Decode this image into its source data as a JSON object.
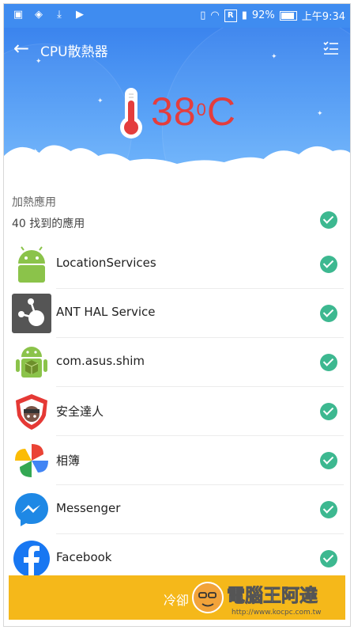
{
  "status_bar": {
    "battery": "92%",
    "time": "上午9:34",
    "sim_label": "R"
  },
  "header": {
    "title": "CPU散熱器",
    "temperature": "38",
    "unit": "C"
  },
  "section": {
    "title": "加熱應用",
    "found": "40 找到的應用"
  },
  "apps": [
    {
      "name": "LocationServices",
      "icon": "android-icon"
    },
    {
      "name": "ANT HAL Service",
      "icon": "ant-hal-icon"
    },
    {
      "name": "com.asus.shim",
      "icon": "android-box-icon"
    },
    {
      "name": "安全達人",
      "icon": "security-master-icon"
    },
    {
      "name": "相簿",
      "icon": "gallery-pinwheel-icon"
    },
    {
      "name": "Messenger",
      "icon": "messenger-icon"
    },
    {
      "name": "Facebook",
      "icon": "facebook-icon"
    }
  ],
  "cool_button": {
    "label": "冷卻"
  },
  "watermark": {
    "name": "電腦王阿達",
    "url": "http://www.kocpc.com.tw"
  },
  "colors": {
    "accent_blue": "#3f8cf0",
    "temperature_red": "#e43d3d",
    "check_green": "#3db890",
    "button_yellow": "#f5b81a"
  }
}
